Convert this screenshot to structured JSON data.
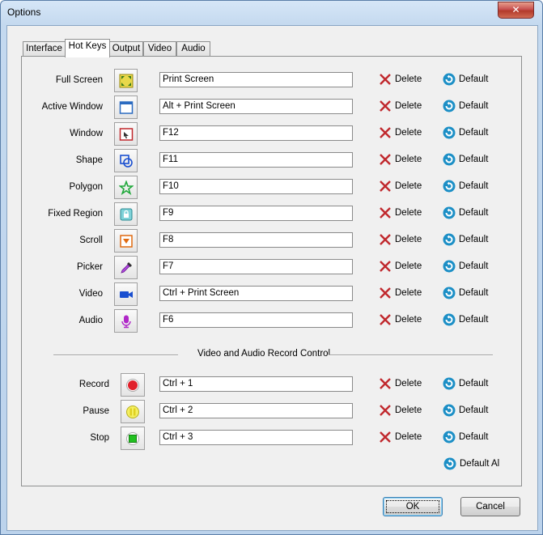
{
  "window": {
    "title": "Options",
    "close_label": "✕"
  },
  "tabs": [
    {
      "label": "Interface"
    },
    {
      "label": "Hot Keys"
    },
    {
      "label": "Output"
    },
    {
      "label": "Video"
    },
    {
      "label": "Audio"
    }
  ],
  "hotkeys": [
    {
      "label": "Full Screen",
      "value": "Print Screen",
      "icon": "fullscreen-icon"
    },
    {
      "label": "Active Window",
      "value": "Alt + Print Screen",
      "icon": "active-window-icon"
    },
    {
      "label": "Window",
      "value": "F12",
      "icon": "window-icon"
    },
    {
      "label": "Shape",
      "value": "F11",
      "icon": "shape-icon"
    },
    {
      "label": "Polygon",
      "value": "F10",
      "icon": "polygon-icon"
    },
    {
      "label": "Fixed Region",
      "value": "F9",
      "icon": "fixed-region-icon"
    },
    {
      "label": "Scroll",
      "value": "F8",
      "icon": "scroll-icon"
    },
    {
      "label": "Picker",
      "value": "F7",
      "icon": "picker-icon"
    },
    {
      "label": "Video",
      "value": "Ctrl + Print Screen",
      "icon": "video-camera-icon"
    },
    {
      "label": "Audio",
      "value": "F6",
      "icon": "microphone-icon"
    }
  ],
  "record_section": {
    "title": "Video and Audio Record Control",
    "items": [
      {
        "label": "Record",
        "value": "Ctrl + 1",
        "icon": "record-icon"
      },
      {
        "label": "Pause",
        "value": "Ctrl + 2",
        "icon": "pause-icon"
      },
      {
        "label": "Stop",
        "value": "Ctrl + 3",
        "icon": "stop-icon"
      }
    ]
  },
  "actions": {
    "delete_label": "Delete",
    "default_label": "Default",
    "default_all_label": "Default Al"
  },
  "footer": {
    "ok_label": "OK",
    "cancel_label": "Cancel"
  },
  "colors": {
    "delete_x": "#c0282d",
    "default_circle": "#1c8fc6",
    "accent_blue": "#3c7fb1"
  }
}
